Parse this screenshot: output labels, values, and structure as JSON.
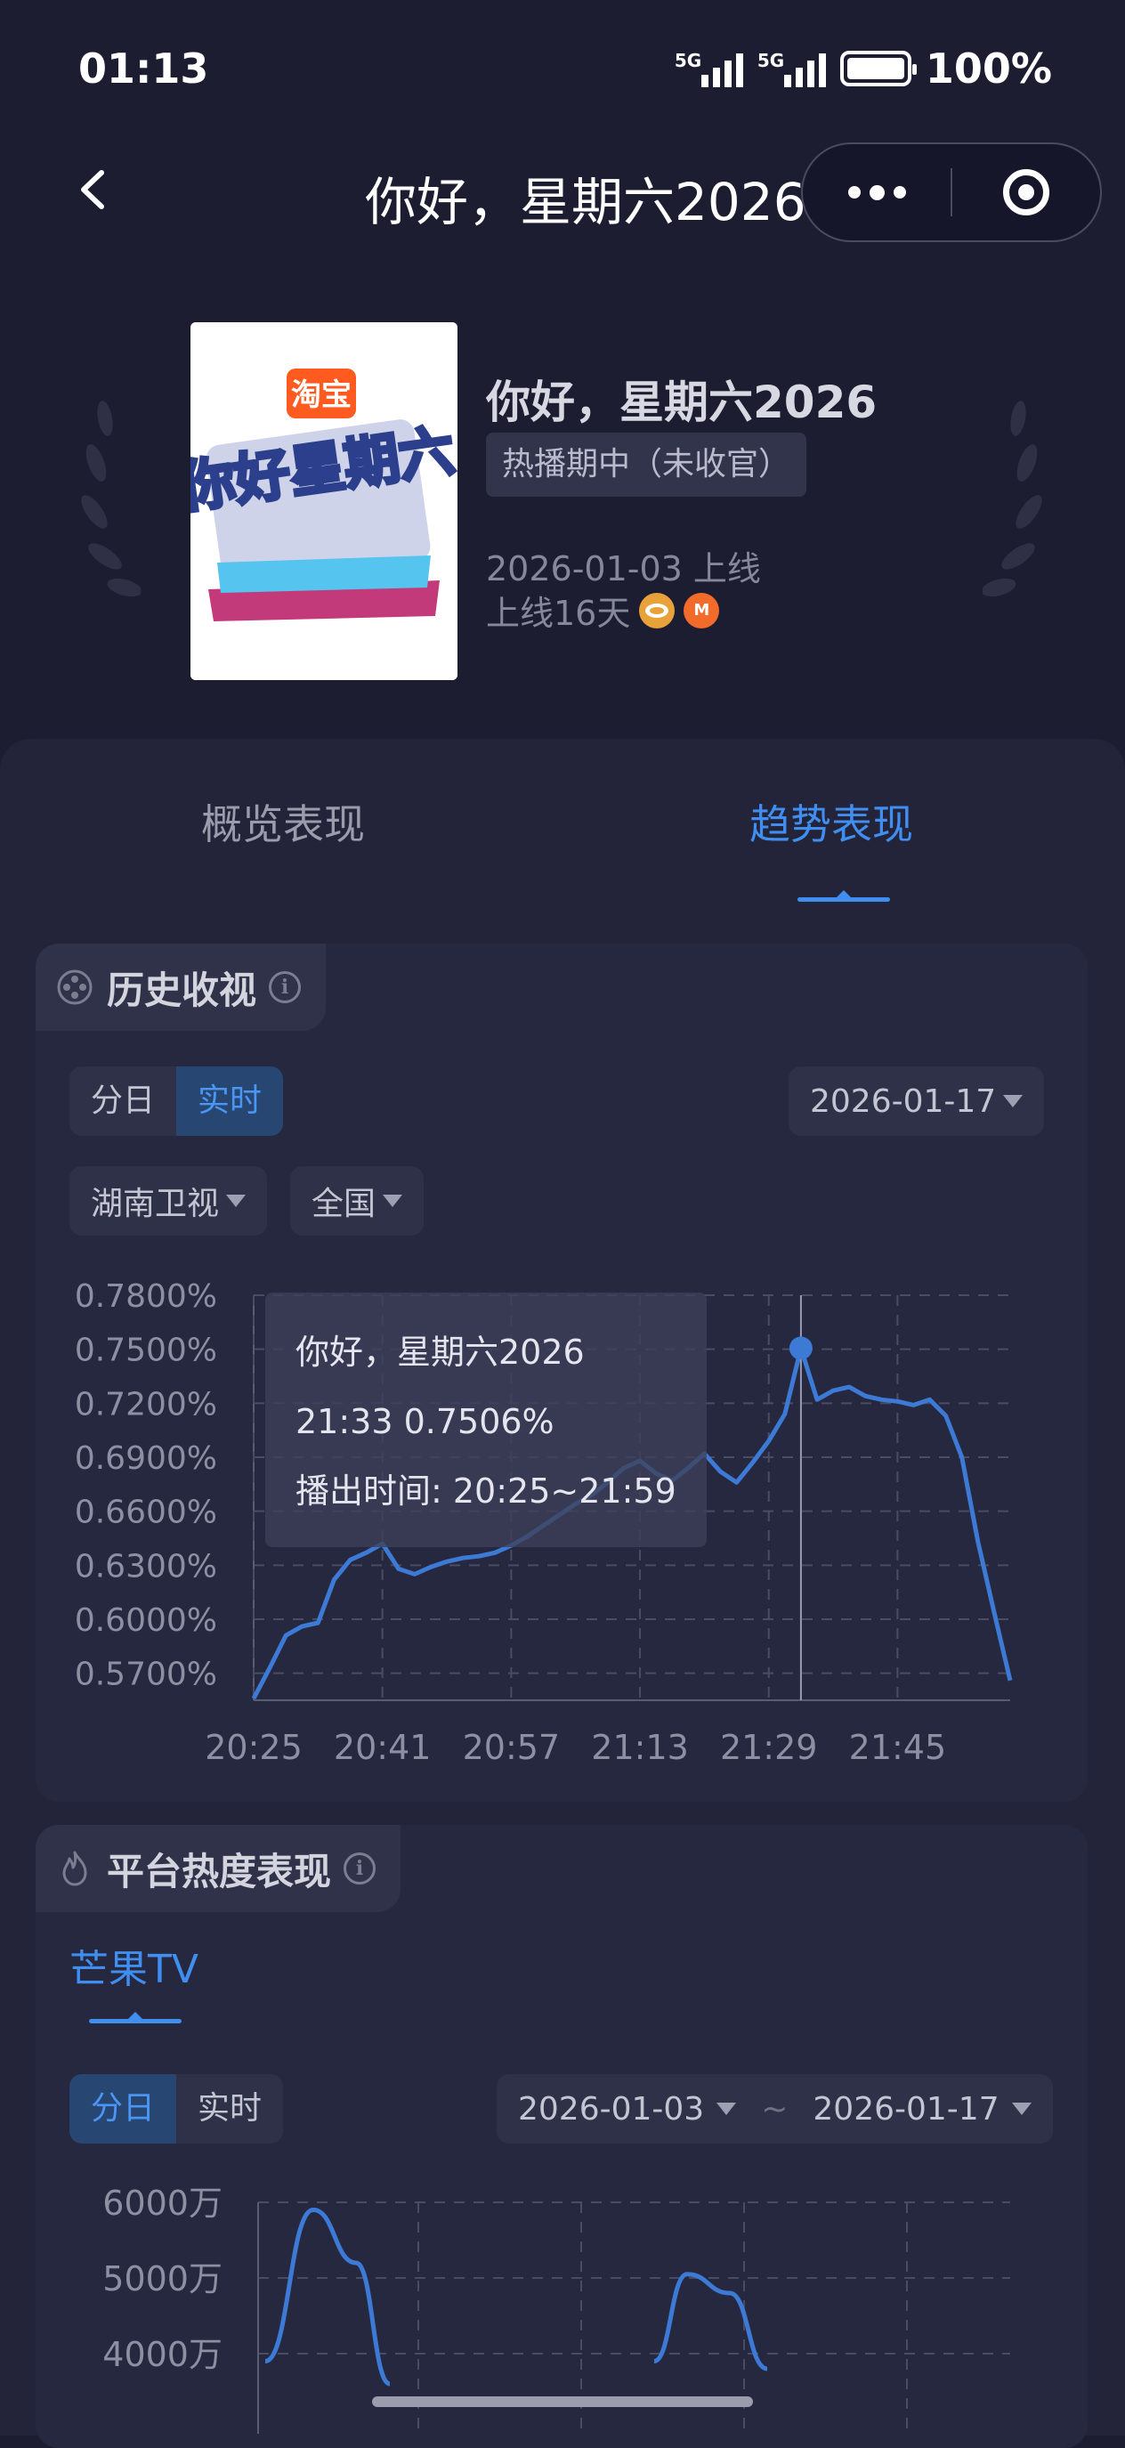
{
  "status_bar": {
    "time": "01:13",
    "battery": "100%",
    "signal_1": "5G",
    "signal_2": "5G"
  },
  "nav": {
    "title": "你好，星期六2026"
  },
  "show": {
    "poster_logo": "淘宝",
    "poster_text": "你好星期六",
    "title": "你好，星期六2026",
    "status_badge": "热播期中（未收官）",
    "launch_date": "2026-01-03 上线",
    "days_online": "上线16天",
    "platforms": [
      "hunan-tv-icon",
      "mango-tv-icon"
    ]
  },
  "tabs": [
    {
      "label": "概览表现",
      "active": false
    },
    {
      "label": "趋势表现",
      "active": true
    }
  ],
  "history_ratings": {
    "title": "历史收视",
    "segment": [
      "分日",
      "实时"
    ],
    "segment_active": "实时",
    "date": "2026-01-17",
    "channel": "湖南卫视",
    "region": "全国",
    "tooltip": {
      "name": "你好，星期六2026",
      "value": "21:33 0.7506%",
      "airtime": "播出时间: 20:25~21:59"
    }
  },
  "chart_data": [
    {
      "type": "line",
      "title": "",
      "y_tick_labels": [
        "0.7800%",
        "0.7500%",
        "0.7200%",
        "0.6900%",
        "0.6600%",
        "0.6300%",
        "0.6000%",
        "0.5700%"
      ],
      "y_ticks": [
        0.78,
        0.75,
        0.72,
        0.69,
        0.66,
        0.63,
        0.6,
        0.57
      ],
      "x_tick_labels": [
        "20:25",
        "20:41",
        "20:57",
        "21:13",
        "21:29",
        "21:45"
      ],
      "ylim": [
        0.555,
        0.78
      ],
      "grid": true,
      "series": [
        {
          "color": "#3d7ad6",
          "x": [
            "20:25",
            "20:27",
            "20:29",
            "20:31",
            "20:33",
            "20:35",
            "20:37",
            "20:39",
            "20:41",
            "20:43",
            "20:45",
            "20:47",
            "20:49",
            "20:51",
            "20:53",
            "20:55",
            "20:57",
            "20:59",
            "21:01",
            "21:03",
            "21:05",
            "21:07",
            "21:09",
            "21:11",
            "21:13",
            "21:15",
            "21:17",
            "21:19",
            "21:21",
            "21:23",
            "21:25",
            "21:27",
            "21:29",
            "21:31",
            "21:33",
            "21:35",
            "21:37",
            "21:39",
            "21:41",
            "21:43",
            "21:45",
            "21:47",
            "21:49",
            "21:51",
            "21:53",
            "21:55",
            "21:57",
            "21:59"
          ],
          "values": [
            0.556,
            0.573,
            0.591,
            0.596,
            0.598,
            0.622,
            0.633,
            0.637,
            0.642,
            0.628,
            0.625,
            0.629,
            0.632,
            0.634,
            0.635,
            0.637,
            0.641,
            0.646,
            0.652,
            0.658,
            0.664,
            0.669,
            0.676,
            0.684,
            0.688,
            0.681,
            0.677,
            0.684,
            0.692,
            0.682,
            0.676,
            0.687,
            0.699,
            0.714,
            0.7506,
            0.722,
            0.727,
            0.729,
            0.724,
            0.722,
            0.721,
            0.719,
            0.722,
            0.713,
            0.69,
            0.643,
            0.604,
            0.566
          ],
          "highlight": {
            "x": "21:33",
            "value": 0.7506
          }
        }
      ]
    },
    {
      "type": "line",
      "title": "",
      "y_tick_labels": [
        "6000万",
        "5000万",
        "4000万"
      ],
      "y_ticks": [
        6000,
        5000,
        4000
      ],
      "ylim": [
        3000,
        6000
      ],
      "grid": true,
      "series": [
        {
          "color": "#3d7ad6",
          "x": [
            0,
            1,
            2,
            3,
            4,
            5,
            6,
            7,
            8,
            9
          ],
          "values": [
            3900,
            5900,
            5200,
            3600,
            null,
            null,
            3900,
            5050,
            4800,
            3800
          ]
        }
      ]
    }
  ],
  "platform_heat": {
    "title": "平台热度表现",
    "platform_tab": "芒果TV",
    "segment": [
      "分日",
      "实时"
    ],
    "segment_active": "分日",
    "date_from": "2026-01-03",
    "date_sep": "~",
    "date_to": "2026-01-17"
  }
}
